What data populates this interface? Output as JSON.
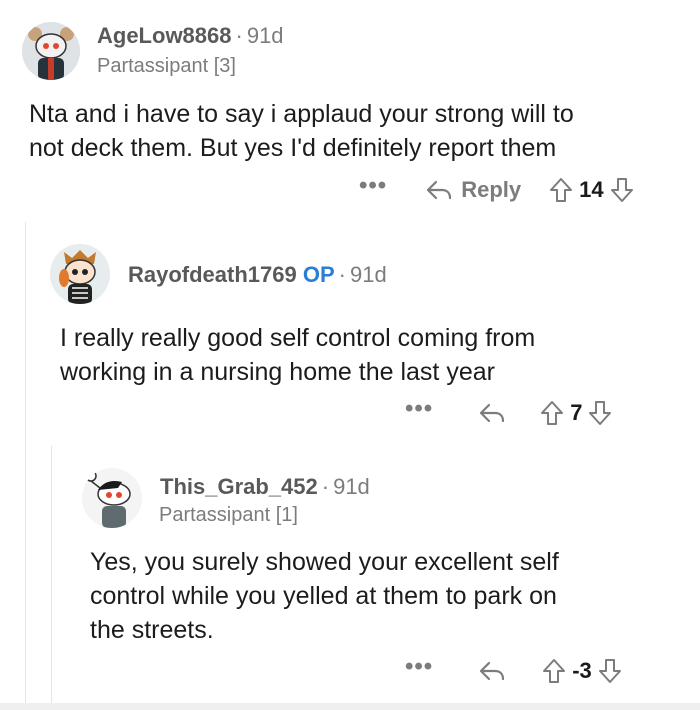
{
  "comments": [
    {
      "username": "AgeLow8868",
      "age": "91d",
      "flair": "Partassipant [3]",
      "op_badge": "",
      "body_lines": [
        "Nta and i have to say i applaud your strong will to",
        "not deck them. But yes I'd definitely report them"
      ],
      "more": "•••",
      "reply_label": "Reply",
      "score": "14"
    },
    {
      "username": "Rayofdeath1769",
      "age": "91d",
      "flair": "",
      "op_badge": "OP",
      "body_lines": [
        "I really really good self control coming from",
        "working in a nursing home the last year"
      ],
      "more": "•••",
      "reply_label": "",
      "score": "7"
    },
    {
      "username": "This_Grab_452",
      "age": "91d",
      "flair": "Partassipant [1]",
      "op_badge": "",
      "body_lines": [
        "Yes, you surely showed your excellent self",
        "control while you yelled at them to park on",
        "the streets."
      ],
      "more": "•••",
      "reply_label": "",
      "score": "-3"
    }
  ],
  "separator": "·",
  "colors": {
    "op_badge": "#2a7fd4",
    "meta_gray": "#7c7c7c",
    "body_text": "#1c1c1c"
  },
  "icons": {
    "reply": "reply-arrow-icon",
    "upvote": "upvote-arrow-icon",
    "downvote": "downvote-arrow-icon",
    "more": "more-options-icon"
  }
}
